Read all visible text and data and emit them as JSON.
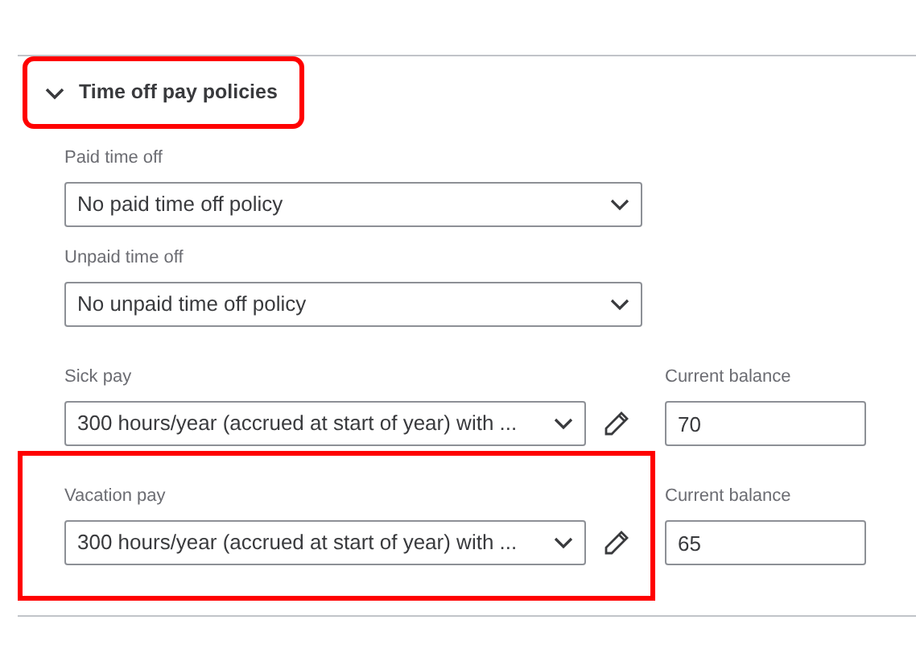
{
  "section": {
    "title": "Time off pay policies",
    "expanded": true,
    "highlighted": true
  },
  "policies": [
    {
      "kind": "select",
      "label": "Paid time off",
      "value": "No paid time off policy"
    },
    {
      "kind": "select",
      "label": "Unpaid time off",
      "value": "No unpaid time off policy"
    },
    {
      "kind": "balance",
      "label": "Sick pay",
      "value": "300 hours/year (accrued at start of year) with ...",
      "balance_label": "Current balance",
      "balance": "70"
    },
    {
      "kind": "balance",
      "label": "Vacation pay",
      "value": "300 hours/year (accrued at start of year) with ...",
      "balance_label": "Current balance",
      "balance": "65",
      "highlighted": true
    }
  ]
}
